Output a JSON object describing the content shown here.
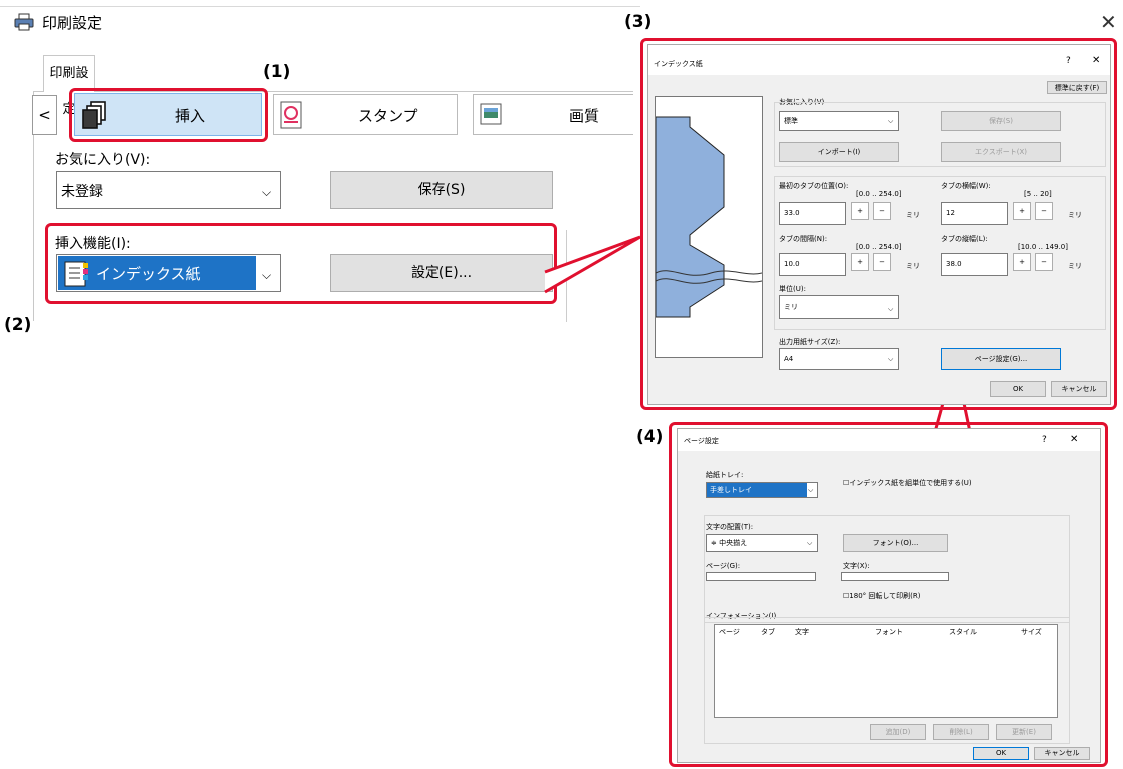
{
  "window": {
    "title": "印刷設定",
    "close": "✕"
  },
  "tabs": {
    "current": "印刷設定"
  },
  "ribbon": {
    "back": "<",
    "insert": "挿入",
    "stamp": "スタンプ",
    "quality": "画質"
  },
  "favorites": {
    "label": "お気に入り(V):",
    "value": "未登録",
    "save": "保存(S)"
  },
  "insert_function": {
    "label": "挿入機能(I):",
    "value": "インデックス紙",
    "settings": "設定(E)..."
  },
  "callouts": {
    "c1": "(1)",
    "c2": "(2)",
    "c3": "(3)",
    "c4": "(4)"
  },
  "colors": {
    "red": "#e0102f",
    "selected_blue": "#1e73c6",
    "ribbon_blue": "#cfe4f6",
    "diagram_blue": "#8fb0dc"
  },
  "index_dialog": {
    "title": "インデックス紙",
    "help": "?",
    "close": "✕",
    "reset": "標準に戻す(F)",
    "favorites_label": "お気に入り(V)",
    "favorites_value": "標準",
    "save": "保存(S)",
    "import": "インポート(I)",
    "export": "エクスポート(X)",
    "first_tab_label": "最初のタブの位置(O):",
    "first_tab_range": "[0.0 .. 254.0]",
    "first_tab_value": "33.0",
    "tab_width_label": "タブの横幅(W):",
    "tab_width_range": "[5 .. 20]",
    "tab_width_value": "12",
    "tab_gap_label": "タブの間隔(N):",
    "tab_gap_range": "[0.0 .. 254.0]",
    "tab_gap_value": "10.0",
    "tab_height_label": "タブの縦幅(L):",
    "tab_height_range": "[10.0 .. 149.0]",
    "tab_height_value": "38.0",
    "plus": "+",
    "minus": "−",
    "unit_mm": "ミリ",
    "unit_label": "単位(U):",
    "unit_value": "ミリ",
    "paper_label": "出力用紙サイズ(Z):",
    "paper_value": "A4",
    "page_setup": "ページ設定(G)...",
    "ok": "OK",
    "cancel": "キャンセル"
  },
  "page_dialog": {
    "title": "ページ設定",
    "help": "?",
    "close": "✕",
    "tray_label": "給紙トレイ:",
    "tray_value": "手差しトレイ",
    "set_unit_check": "インデックス紙を組単位で使用する(U)",
    "text_pos_label": "文字の配置(T):",
    "text_pos_value": "中央揃え",
    "font_button": "フォント(O)...",
    "page_label": "ページ(G):",
    "text_label": "文字(X):",
    "rotate_check": "180° 回転して印刷(R)",
    "info_label": "インフォメーション(I)",
    "columns": [
      "ページ",
      "タブ",
      "文字",
      "フォント",
      "スタイル",
      "サイズ"
    ],
    "add": "追加(D)",
    "delete": "削除(L)",
    "update": "更新(E)",
    "ok": "OK",
    "cancel": "キャンセル"
  }
}
